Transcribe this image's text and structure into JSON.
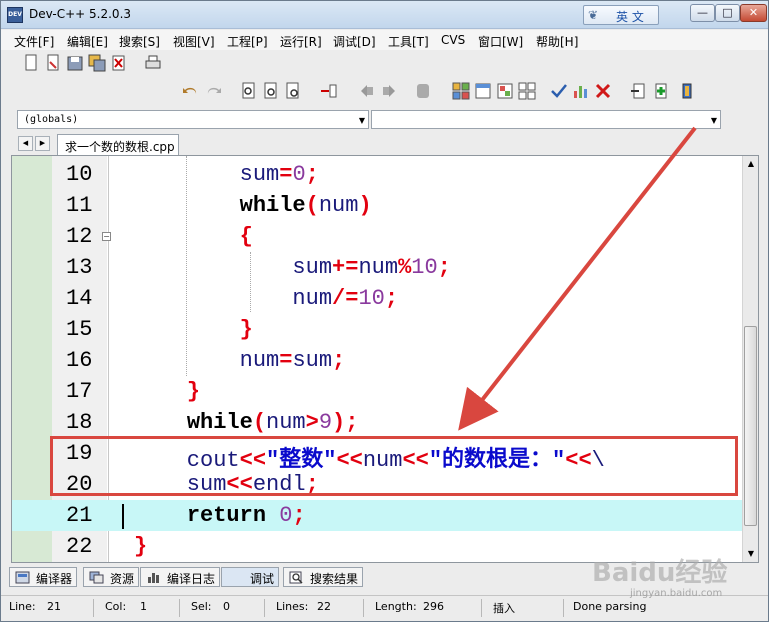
{
  "window": {
    "title": "Dev-C++ 5.2.0.3",
    "app_icon_text": "DEV"
  },
  "ime": {
    "label": "英 文",
    "icon": "ime-logo-icon"
  },
  "window_controls": {
    "minimize": "—",
    "maximize": "□",
    "close": "✕"
  },
  "menu": [
    "文件[F]",
    "编辑[E]",
    "搜索[S]",
    "视图[V]",
    "工程[P]",
    "运行[R]",
    "调试[D]",
    "工具[T]",
    "CVS",
    "窗口[W]",
    "帮助[H]"
  ],
  "toolbar1_icons": [
    "new-file-icon",
    "open-file-icon",
    "save-icon",
    "save-all-icon",
    "close-file-icon",
    "print-icon"
  ],
  "toolbar2_icons": [
    "undo-icon",
    "redo-icon",
    "find-icon",
    "replace-icon",
    "find-next-icon",
    "goto-line-icon",
    "back-icon",
    "forward-icon",
    "bookmark-icon",
    "new-project-icon",
    "class-browser-icon",
    "compile-icon",
    "run-icon",
    "check-icon",
    "chart-icon",
    "delete-icon",
    "insert-icon",
    "add-icon",
    "exit-icon"
  ],
  "combos": {
    "scope": "(globals)",
    "symbol": ""
  },
  "tab": {
    "filename": "求一个数的数根.cpp"
  },
  "code_lines": [
    {
      "num": "10",
      "tokens": [
        {
          "t": "        sum",
          "c": "id"
        },
        {
          "t": "=",
          "c": "op"
        },
        {
          "t": "0",
          "c": "num"
        },
        {
          "t": ";",
          "c": "op"
        }
      ]
    },
    {
      "num": "11",
      "tokens": [
        {
          "t": "        ",
          "c": "id"
        },
        {
          "t": "while",
          "c": "kw"
        },
        {
          "t": "(",
          "c": "op"
        },
        {
          "t": "num",
          "c": "id"
        },
        {
          "t": ")",
          "c": "op"
        }
      ]
    },
    {
      "num": "12",
      "tokens": [
        {
          "t": "        ",
          "c": "id"
        },
        {
          "t": "{",
          "c": "op"
        }
      ]
    },
    {
      "num": "13",
      "tokens": [
        {
          "t": "            sum",
          "c": "id"
        },
        {
          "t": "+=",
          "c": "op"
        },
        {
          "t": "num",
          "c": "id"
        },
        {
          "t": "%",
          "c": "op"
        },
        {
          "t": "10",
          "c": "num"
        },
        {
          "t": ";",
          "c": "op"
        }
      ]
    },
    {
      "num": "14",
      "tokens": [
        {
          "t": "            num",
          "c": "id"
        },
        {
          "t": "/=",
          "c": "op"
        },
        {
          "t": "10",
          "c": "num"
        },
        {
          "t": ";",
          "c": "op"
        }
      ]
    },
    {
      "num": "15",
      "tokens": [
        {
          "t": "        ",
          "c": "id"
        },
        {
          "t": "}",
          "c": "op"
        }
      ]
    },
    {
      "num": "16",
      "tokens": [
        {
          "t": "        num",
          "c": "id"
        },
        {
          "t": "=",
          "c": "op"
        },
        {
          "t": "sum",
          "c": "id"
        },
        {
          "t": ";",
          "c": "op"
        }
      ]
    },
    {
      "num": "17",
      "tokens": [
        {
          "t": "    ",
          "c": "id"
        },
        {
          "t": "}",
          "c": "op"
        }
      ]
    },
    {
      "num": "18",
      "tokens": [
        {
          "t": "    ",
          "c": "id"
        },
        {
          "t": "while",
          "c": "kw"
        },
        {
          "t": "(",
          "c": "op"
        },
        {
          "t": "num",
          "c": "id"
        },
        {
          "t": ">",
          "c": "op"
        },
        {
          "t": "9",
          "c": "num"
        },
        {
          "t": ");",
          "c": "op"
        }
      ]
    },
    {
      "num": "19",
      "tokens": [
        {
          "t": "    cout",
          "c": "id"
        },
        {
          "t": "<<",
          "c": "op"
        },
        {
          "t": "\"整数\"",
          "c": "str"
        },
        {
          "t": "<<",
          "c": "op"
        },
        {
          "t": "num",
          "c": "id"
        },
        {
          "t": "<<",
          "c": "op"
        },
        {
          "t": "\"的数根是：\"",
          "c": "str"
        },
        {
          "t": "<<",
          "c": "op"
        },
        {
          "t": "\\",
          "c": "id"
        }
      ]
    },
    {
      "num": "20",
      "tokens": [
        {
          "t": "    sum",
          "c": "id"
        },
        {
          "t": "<<",
          "c": "op"
        },
        {
          "t": "endl",
          "c": "id"
        },
        {
          "t": ";",
          "c": "op"
        }
      ]
    },
    {
      "num": "21",
      "tokens": [
        {
          "t": "    ",
          "c": "id"
        },
        {
          "t": "return",
          "c": "kw"
        },
        {
          "t": " ",
          "c": "id"
        },
        {
          "t": "0",
          "c": "num"
        },
        {
          "t": ";",
          "c": "op"
        }
      ],
      "current": true
    },
    {
      "num": "22",
      "tokens": [
        {
          "t": "",
          "c": "id"
        },
        {
          "t": "}",
          "c": "op"
        }
      ]
    }
  ],
  "syntax_colors": {
    "id": "#1a1a7a",
    "op": "#e2000f",
    "num": "#8a3a9e",
    "str": "#0a0acc",
    "kw": "#000000"
  },
  "bottom_tabs": [
    {
      "label": "编译器",
      "icon": "compiler-icon"
    },
    {
      "label": "资源",
      "icon": "resources-icon"
    },
    {
      "label": "编译日志",
      "icon": "compile-log-icon"
    },
    {
      "label": "调试",
      "icon": "debug-icon"
    },
    {
      "label": "搜索结果",
      "icon": "search-results-icon"
    }
  ],
  "status": {
    "line_label": "Line:",
    "line_value": "21",
    "col_label": "Col:",
    "col_value": "1",
    "sel_label": "Sel:",
    "sel_value": "0",
    "lines_label": "Lines:",
    "lines_value": "22",
    "length_label": "Length:",
    "length_value": "296",
    "mode": "插入",
    "message": "Done parsing"
  },
  "annotation": {
    "color": "#d9473f"
  },
  "watermark": {
    "text": "Baidu经验",
    "url": "jingyan.baidu.com"
  }
}
